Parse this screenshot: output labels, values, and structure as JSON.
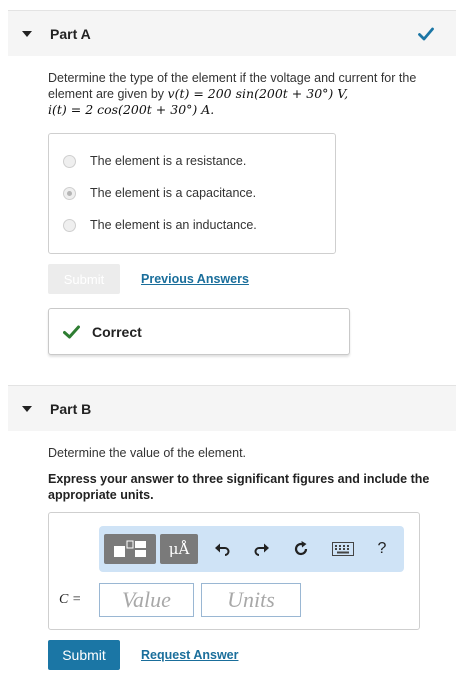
{
  "part_a": {
    "title": "Part A",
    "status_icon": "checkmark-icon",
    "question_prefix": "Determine the type of the element if the voltage and current for the element are given by ",
    "voltage_expr": "v(t) = 200 sin(200t + 30°) V,",
    "current_expr": "i(t) = 2 cos(200t + 30°) A.",
    "choices": [
      {
        "label": "The element is a resistance.",
        "selected": false
      },
      {
        "label": "The element is a capacitance.",
        "selected": true
      },
      {
        "label": "The element is an inductance.",
        "selected": false
      }
    ],
    "submit_label": "Submit",
    "previous_answers_label": "Previous Answers",
    "feedback_label": "Correct",
    "colors": {
      "correct": "#2e7d32"
    }
  },
  "part_b": {
    "title": "Part B",
    "question": "Determine the value of the element.",
    "instruction": "Express your answer to three significant figures and include the appropriate units.",
    "toolbar": {
      "templates_icon": "templates-icon",
      "units_label": "μÅ",
      "undo_icon": "undo-icon",
      "redo_icon": "redo-icon",
      "reset_icon": "reset-icon",
      "keyboard_icon": "keyboard-icon",
      "help_label": "?"
    },
    "variable_label": "C =",
    "value_placeholder": "Value",
    "units_placeholder": "Units",
    "submit_label": "Submit",
    "request_answer_label": "Request Answer"
  }
}
